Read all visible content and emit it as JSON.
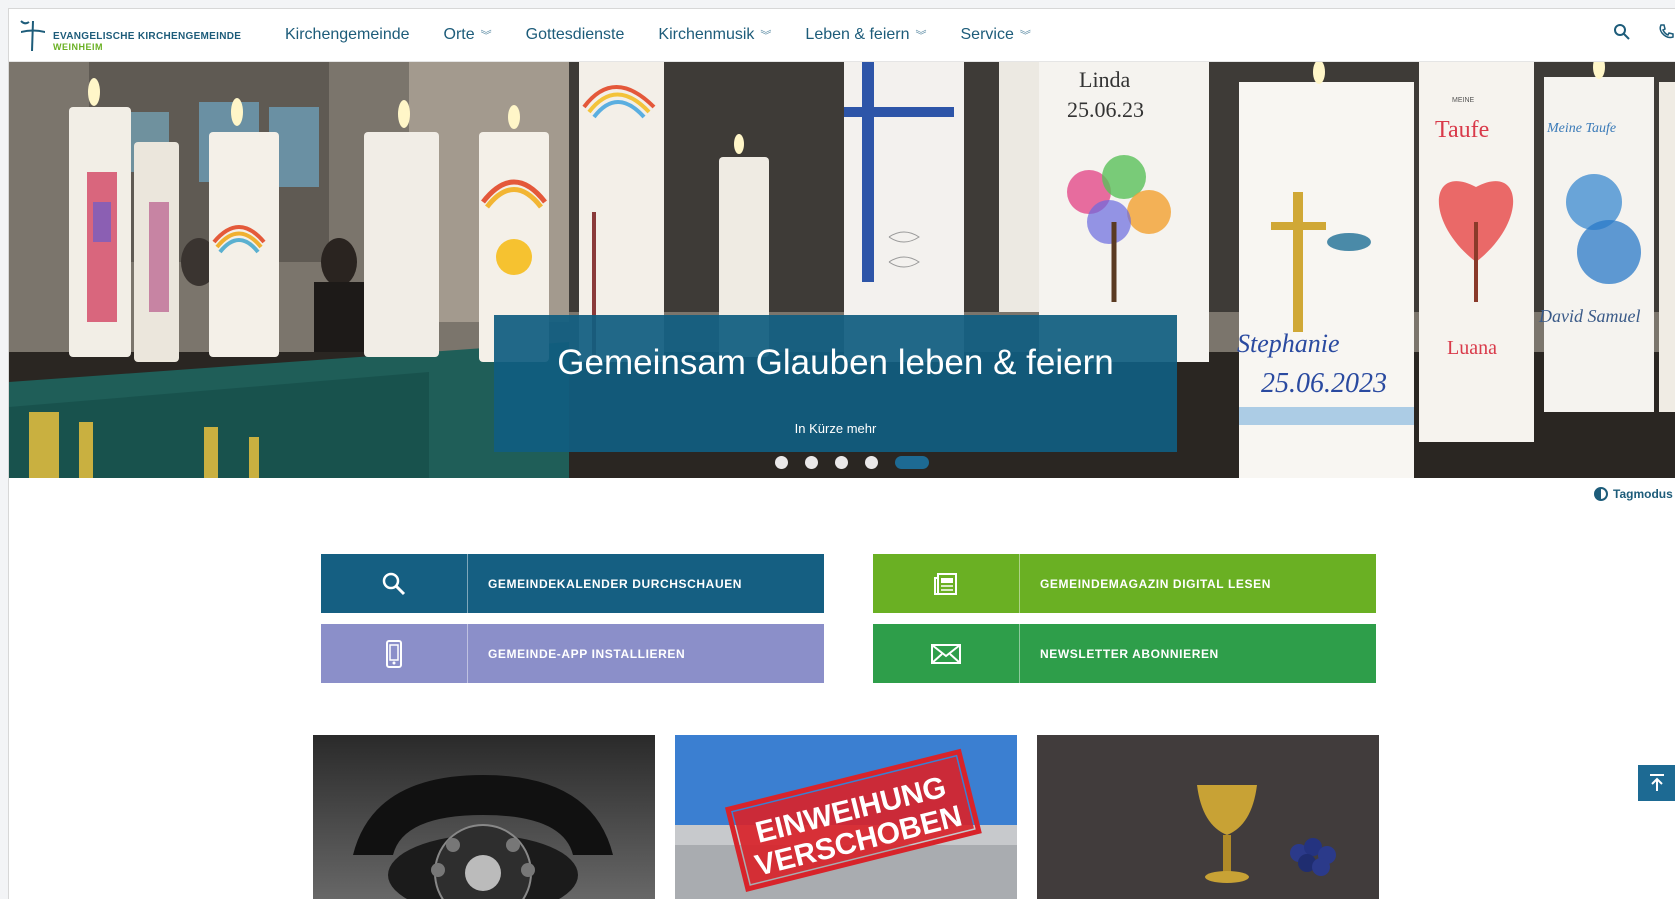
{
  "logo": {
    "line1": "EVANGELISCHE KIRCHENGEMEINDE",
    "line2": "WEINHEIM"
  },
  "nav": [
    {
      "label": "Kirchengemeinde",
      "chevron": false
    },
    {
      "label": "Orte",
      "chevron": true
    },
    {
      "label": "Gottesdienste",
      "chevron": false
    },
    {
      "label": "Kirchenmusik",
      "chevron": true
    },
    {
      "label": "Leben & feiern",
      "chevron": true
    },
    {
      "label": "Service",
      "chevron": true
    }
  ],
  "header_icons": [
    "search-icon",
    "phone-icon"
  ],
  "hero": {
    "title": "Gemeinsam Glauben leben & feiern",
    "subtitle": "In Kürze mehr",
    "slides": 5,
    "active_slide": 5,
    "candle_texts": {
      "linda": "Linda",
      "linda_date": "25.06.23",
      "taufe": "Taufe",
      "meine": "MEINE",
      "luana": "Luana",
      "stephanie": "Stephanie",
      "stephanie_date": "25.06.2023",
      "meine_taufe": "Meine Taufe",
      "david": "David Samuel"
    }
  },
  "daymode": {
    "label": "Tagmodus"
  },
  "tiles": [
    {
      "label": "Gemeindekalender durchschauen",
      "icon": "search-icon",
      "color": "#155f82"
    },
    {
      "label": "Gemeindemagazin digital lesen",
      "icon": "newspaper-icon",
      "color": "#6ab023"
    },
    {
      "label": "Gemeinde-App installieren",
      "icon": "smartphone-icon",
      "color": "#8b8fc9"
    },
    {
      "label": "Newsletter abonnieren",
      "icon": "envelope-icon",
      "color": "#2e9e4a"
    }
  ],
  "cards": {
    "stamp_line1": "EINWEIHUNG",
    "stamp_line2": "VERSCHOBEN"
  },
  "back_to_top": {
    "icon": "arrow-up-icon"
  }
}
